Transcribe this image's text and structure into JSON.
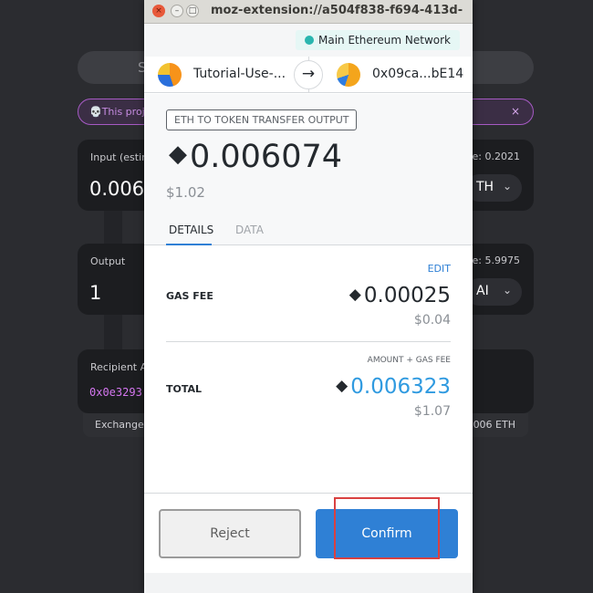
{
  "background": {
    "top_bar_text": "S",
    "warning": {
      "icon": "skull-icon",
      "text": "This proj",
      "close": "×"
    },
    "input_card": {
      "label": "Input (estim",
      "value": "0.006",
      "right_label": "ce: 0.2021",
      "token": "TH",
      "chevron": "⌄"
    },
    "output_card": {
      "label": "Output",
      "value": "1",
      "right_label": "ce: 5.9975",
      "token": "AI",
      "chevron": "⌄"
    },
    "recipient_card": {
      "label": "Recipient A",
      "address": "0x0e3293"
    },
    "footer": {
      "left": "Exchange",
      "right": "006 ETH"
    }
  },
  "window": {
    "title": "moz-extension://a504f838-f694-413d-",
    "buttons": {
      "close": "×",
      "minimize": "–",
      "maximize": "□"
    }
  },
  "network": {
    "name": "Main Ethereum Network",
    "dot_color": "#29b6af"
  },
  "accounts": {
    "from": {
      "name": "Tutorial-Use-..."
    },
    "to": {
      "name": "0x09ca...bE14"
    },
    "arrow": "→"
  },
  "summary": {
    "action": "ETH TO TOKEN TRANSFER OUTPUT",
    "eth_symbol": "◆",
    "amount": "0.006074",
    "fiat": "$1.02",
    "tabs": {
      "details": "DETAILS",
      "data": "DATA"
    }
  },
  "details": {
    "edit": "EDIT",
    "gas_fee": {
      "label": "GAS FEE",
      "value": "0.00025",
      "fiat": "$0.04"
    },
    "total": {
      "caption": "AMOUNT + GAS FEE",
      "label": "TOTAL",
      "value": "0.006323",
      "fiat": "$1.07"
    }
  },
  "actions": {
    "reject": "Reject",
    "confirm": "Confirm"
  },
  "colors": {
    "accent": "#2f80d5",
    "total_text": "#2f9ae0",
    "highlight": "#d94141"
  }
}
